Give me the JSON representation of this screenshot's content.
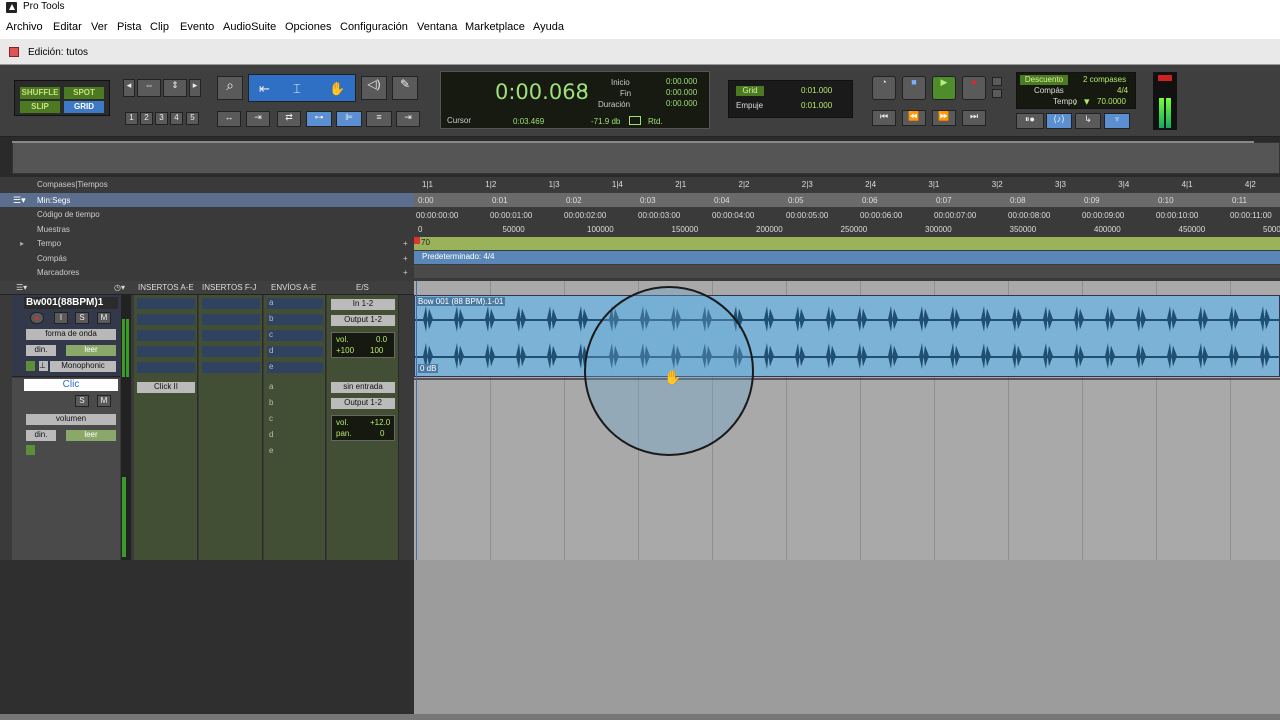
{
  "app": {
    "title": "Pro Tools"
  },
  "menu": [
    "Archivo",
    "Editar",
    "Ver",
    "Pista",
    "Clip",
    "Evento",
    "AudioSuite",
    "Opciones",
    "Configuración",
    "Ventana",
    "Marketplace",
    "Ayuda"
  ],
  "window": {
    "title": "Edición: tutos"
  },
  "edit_modes": {
    "shuffle": "SHUFFLE",
    "spot": "SPOT",
    "slip": "SLIP",
    "grid": "GRID"
  },
  "zoom_presets": [
    "1",
    "2",
    "3",
    "4",
    "5"
  ],
  "counter": {
    "main": "0:00.068",
    "inicio_label": "Inicio",
    "inicio": "0:00.000",
    "fin_label": "Fin",
    "fin": "0:00.000",
    "duracion_label": "Duración",
    "duracion": "0:00.000",
    "cursor_label": "Cursor",
    "cursor": "0:03.469",
    "db": "-71.9 db",
    "rtd": "Rtd."
  },
  "grid": {
    "grid_label": "Grid",
    "grid_value": "0:01.000",
    "nudge_label": "Empuje",
    "nudge_value": "0:01.000"
  },
  "transport_extra": {
    "descuento": "Descuento",
    "compases": "2 compases",
    "compas_label": "Compás",
    "compas": "4/4",
    "tempo_label": "Tempo",
    "tempo": "70.0000"
  },
  "rulers": {
    "labels": [
      "Compases|Tiempos",
      "Min:Segs",
      "Código de tiempo",
      "Muestras",
      "Tempo",
      "Compás",
      "Marcadores"
    ],
    "bars": [
      "1|1",
      "1|2",
      "1|3",
      "1|4",
      "2|1",
      "2|2",
      "2|3",
      "2|4",
      "3|1",
      "3|2",
      "3|3",
      "3|4",
      "4|1",
      "4|2"
    ],
    "minsec": [
      "0:00",
      "0:01",
      "0:02",
      "0:03",
      "0:04",
      "0:05",
      "0:06",
      "0:07",
      "0:08",
      "0:09",
      "0:10",
      "0:11"
    ],
    "timecode": [
      "00:00:00:00",
      "00:00:01:00",
      "00:00:02:00",
      "00:00:03:00",
      "00:00:04:00",
      "00:00:05:00",
      "00:00:06:00",
      "00:00:07:00",
      "00:00:08:00",
      "00:00:09:00",
      "00:00:10:00",
      "00:00:11:00"
    ],
    "samples": [
      "0",
      "50000",
      "100000",
      "150000",
      "200000",
      "250000",
      "300000",
      "350000",
      "400000",
      "450000",
      "5000"
    ],
    "tempo_value": "70",
    "meter_value": "Predeterminado: 4/4"
  },
  "track_header": {
    "insertos_ae": "INSERTOS A-E",
    "insertos_fj": "INSERTOS F-J",
    "envios_ae": "ENVÍOS A-E",
    "es": "E/S"
  },
  "tracks": [
    {
      "name": "Bw001(88BPM)1",
      "view": "forma de onda",
      "din": "din.",
      "leer": "leer",
      "mono": "Monophonic",
      "input": "In 1-2",
      "output": "Output 1-2",
      "vol_label": "vol.",
      "vol": "0.0",
      "pan_l": "+100",
      "pan_r": "100",
      "sends": [
        "a",
        "b",
        "c",
        "d",
        "e"
      ],
      "clip_name": "Bow 001 (88 BPM).1-01",
      "clip_gain": "0 dB"
    },
    {
      "name": "Clic",
      "view": "volumen",
      "din": "din.",
      "leer": "leer",
      "insert": "Click II",
      "input": "sin entrada",
      "output": "Output 1-2",
      "vol_label": "vol.",
      "vol": "+12.0",
      "pan_label": "pan.",
      "pan": "0",
      "sends": [
        "a",
        "b",
        "c",
        "d",
        "e"
      ]
    }
  ],
  "colors": {
    "clip": "#7bb2d6",
    "wave": "#1f4f72",
    "mixer": "#434f34",
    "tempo_ruler": "#9ab35a",
    "meter_ruler": "#5b87b8"
  }
}
